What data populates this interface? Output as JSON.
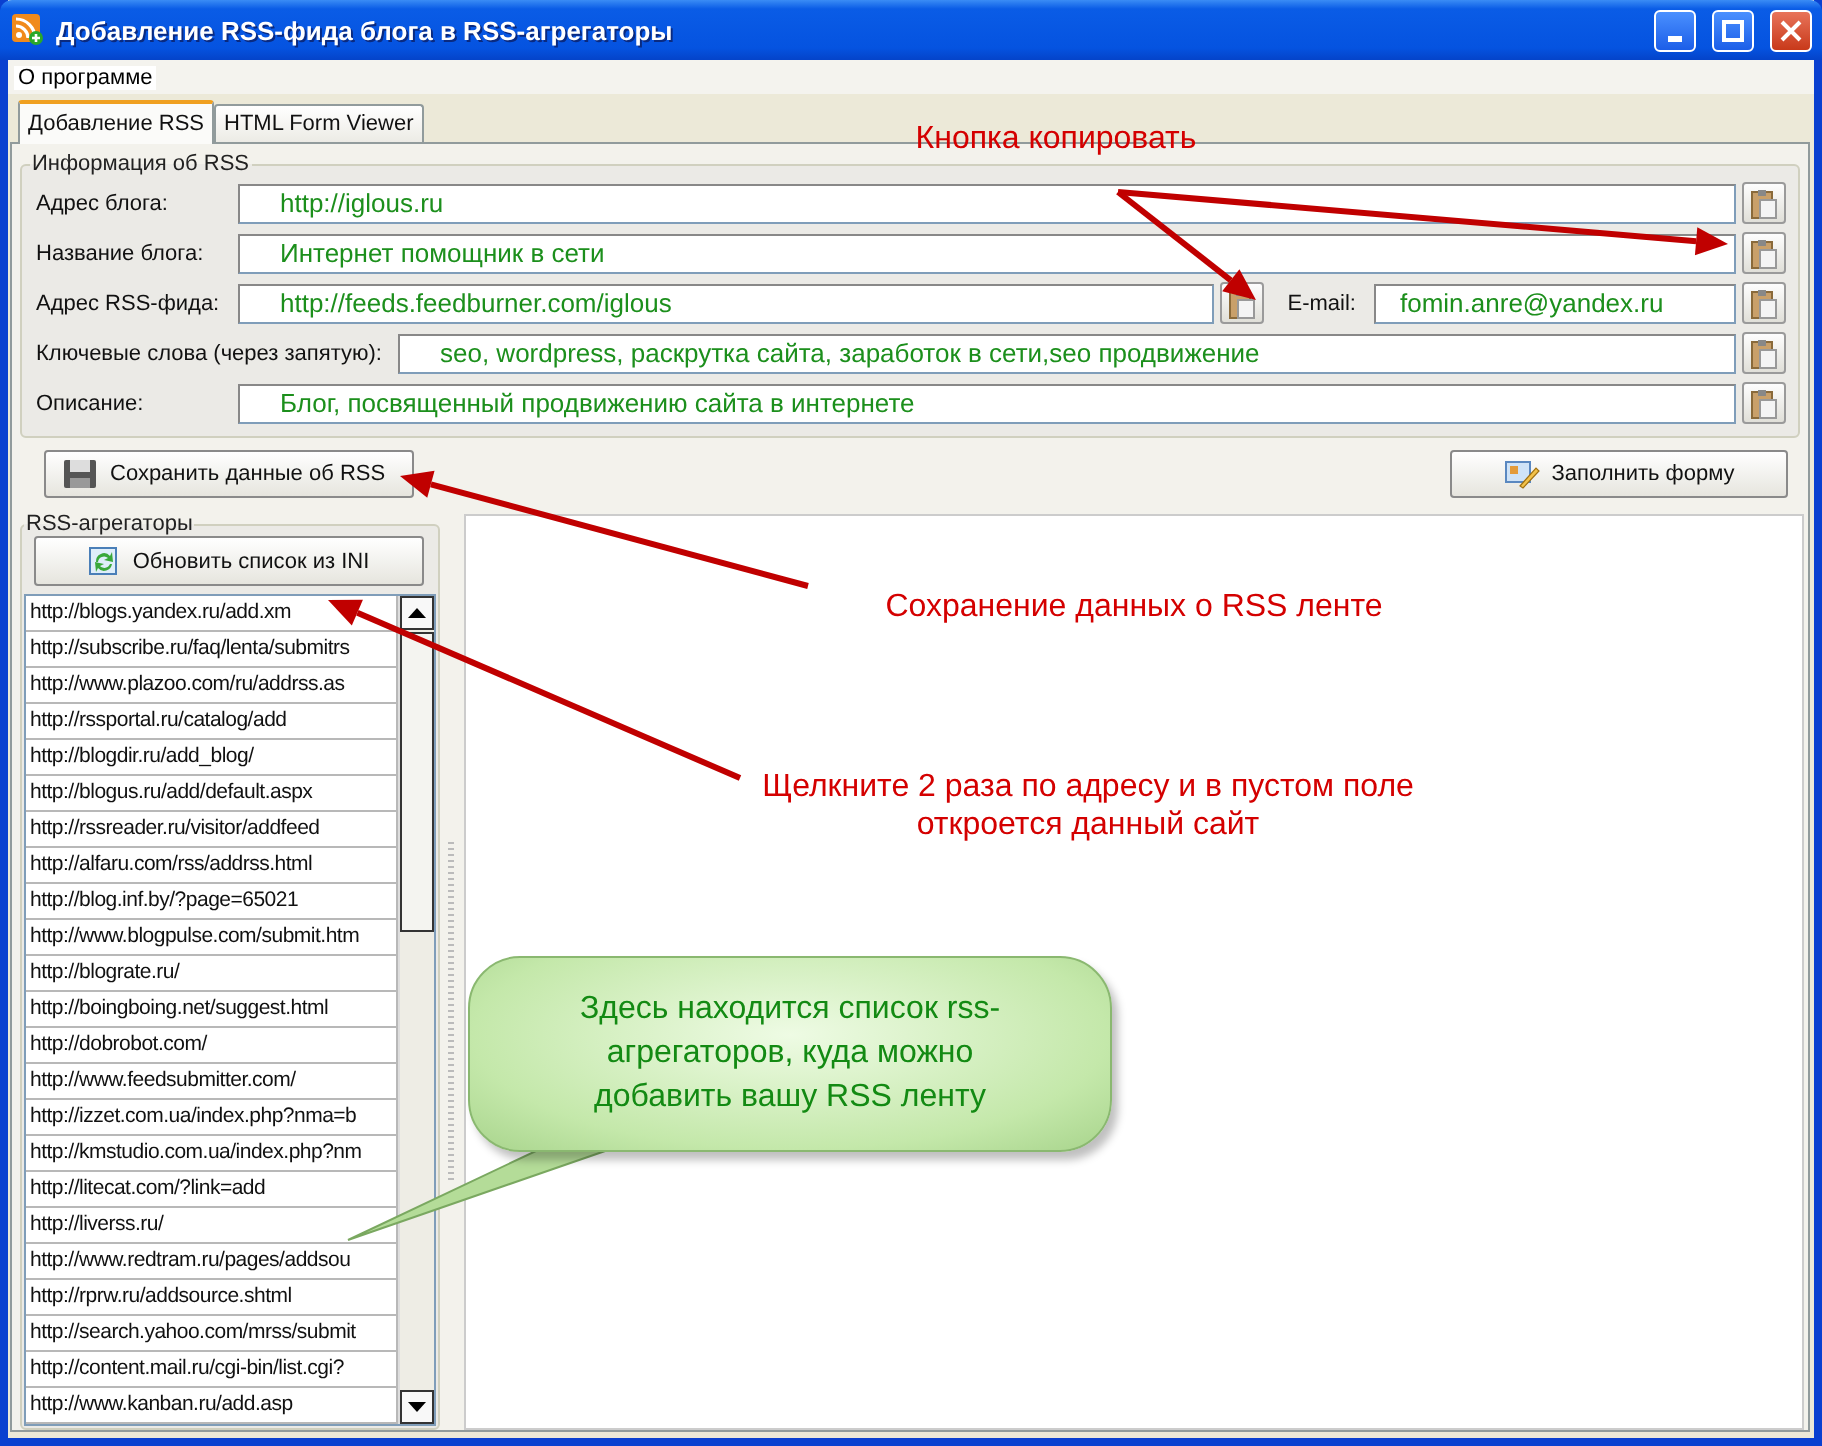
{
  "window": {
    "title": "Добавление RSS-фида блога в RSS-агрегаторы"
  },
  "menu": [
    {
      "label": "О программе"
    }
  ],
  "tabs": [
    {
      "label": "Добавление RSS",
      "selected": true
    },
    {
      "label": "HTML Form Viewer",
      "selected": false
    }
  ],
  "rss_info": {
    "title": "Информация об RSS",
    "fields": [
      {
        "label": "Адрес блога:",
        "value": "http://iglous.ru"
      },
      {
        "label": "Название блога:",
        "value": "Интернет помощник в сети"
      },
      {
        "label": "Адрес RSS-фида:",
        "value": "http://feeds.feedburner.com/iglous",
        "extra": {
          "label": "E-mail:",
          "value": "fomin.anre@yandex.ru"
        }
      },
      {
        "label": "Ключевые слова (через запятую):",
        "value": "seo, wordpress, раскрутка сайта, заработок в сети,seo продвижение"
      },
      {
        "label": "Описание:",
        "value": "Блог, посвященный продвижению сайта в интернете"
      }
    ]
  },
  "buttons": [
    {
      "kind": "save",
      "label": "Сохранить данные об RSS"
    },
    {
      "kind": "fill",
      "label": "Заполнить форму"
    }
  ],
  "aggregators": {
    "title": "RSS-агрегаторы",
    "refresh_button": "Обновить список из INI",
    "items": [
      "http://blogs.yandex.ru/add.xm",
      "http://subscribe.ru/faq/lenta/submitrs",
      "http://www.plazoo.com/ru/addrss.as",
      "http://rssportal.ru/catalog/add",
      "http://blogdir.ru/add_blog/",
      "http://blogus.ru/add/default.aspx",
      "http://rssreader.ru/visitor/addfeed",
      "http://alfaru.com/rss/addrss.html",
      "http://blog.inf.by/?page=65021",
      "http://www.blogpulse.com/submit.htm",
      "http://blograte.ru/",
      "http://boingboing.net/suggest.html",
      "http://dobrobot.com/",
      "http://www.feedsubmitter.com/",
      "http://izzet.com.ua/index.php?nma=b",
      "http://kmstudio.com.ua/index.php?nm",
      "http://litecat.com/?link=add",
      "http://liverss.ru/",
      "http://www.redtram.ru/pages/addsou",
      "http://rprw.ru/addsource.shtml",
      "http://search.yahoo.com/mrss/submit",
      "http://content.mail.ru/cgi-bin/list.cgi?",
      "http://www.kanban.ru/add.asp"
    ]
  },
  "annotations": [
    {
      "kind": "label",
      "text": "Кнопка копировать"
    },
    {
      "kind": "label",
      "text": "Сохранение данных о RSS ленте"
    },
    {
      "kind": "label",
      "text": "Щелкните 2 раза по адресу и в пустом поле откроется данный сайт"
    },
    {
      "kind": "callout",
      "text": "Здесь находится список rss-агрегаторов, куда можно добавить вашу RSS ленту"
    }
  ]
}
